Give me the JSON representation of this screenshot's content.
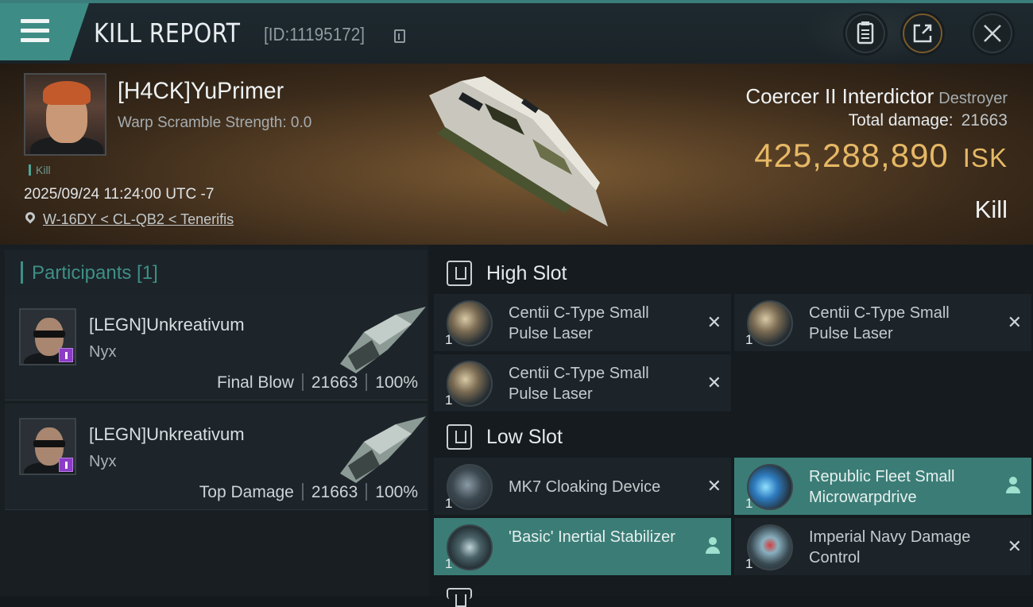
{
  "header": {
    "title": "KILL REPORT",
    "report_id": "[ID:11195172]",
    "icons": [
      "menu-icon",
      "copy-icon",
      "clipboard-icon",
      "share-icon",
      "close-icon"
    ]
  },
  "victim": {
    "name": "[H4CK]YuPrimer",
    "warp_scramble": "Warp Scramble Strength: 0.0",
    "tag": "Kill",
    "datetime": "2025/09/24 11:24:00 UTC -7",
    "location": "W-16DY < CL-QB2 < Tenerifis",
    "ship_name": "Coercer II Interdictor",
    "ship_class": "Destroyer",
    "total_damage_label": "Total damage:",
    "total_damage": "21663",
    "isk_value": "425,288,890",
    "isk_unit": "ISK",
    "result": "Kill"
  },
  "participants": {
    "title": "Participants [1]",
    "rows": [
      {
        "name": "[LEGN]Unkreativum",
        "ship": "Nyx",
        "role": "Final Blow",
        "damage": "21663",
        "percent": "100%"
      },
      {
        "name": "[LEGN]Unkreativum",
        "ship": "Nyx",
        "role": "Top Damage",
        "damage": "21663",
        "percent": "100%"
      }
    ]
  },
  "fitting": {
    "high_slot": {
      "title": "High Slot",
      "items": [
        {
          "qty": "1",
          "name": "Centii C-Type Small Pulse Laser",
          "status": "destroyed"
        },
        {
          "qty": "1",
          "name": "Centii C-Type Small Pulse Laser",
          "status": "destroyed"
        },
        {
          "qty": "1",
          "name": "Centii C-Type Small Pulse Laser",
          "status": "destroyed"
        }
      ]
    },
    "low_slot": {
      "title": "Low Slot",
      "items": [
        {
          "qty": "1",
          "name": "MK7 Cloaking Device",
          "status": "destroyed"
        },
        {
          "qty": "1",
          "name": "Republic Fleet Small Microwarpdrive",
          "status": "dropped"
        },
        {
          "qty": "1",
          "name": "'Basic' Inertial Stabilizer",
          "status": "dropped"
        },
        {
          "qty": "1",
          "name": "Imperial Navy Damage Control",
          "status": "destroyed"
        }
      ]
    }
  },
  "colors": {
    "accent": "#3e8c86",
    "isk": "#e6b866",
    "highlight_item": "#3b7d76",
    "corp_badge": "#8c3cc6"
  }
}
